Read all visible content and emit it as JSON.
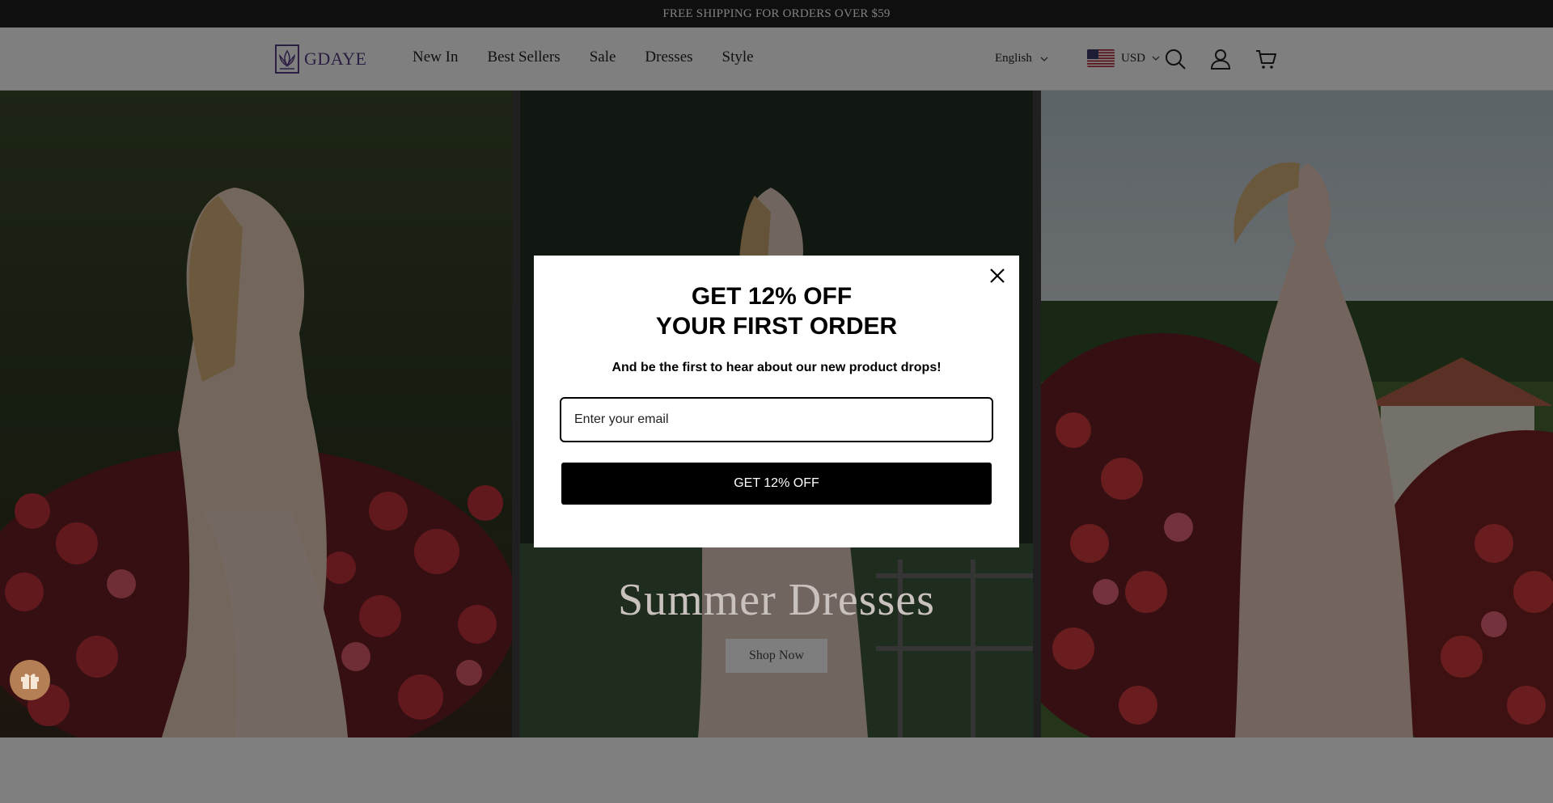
{
  "announcement": {
    "text": "FREE SHIPPING FOR ORDERS OVER $59"
  },
  "header": {
    "logo_text": "GDAYE",
    "nav": [
      "New In",
      "Best Sellers",
      "Sale",
      "Dresses",
      "Style"
    ],
    "language": "English",
    "currency": "USD"
  },
  "hero": {
    "title": "Summer Dresses",
    "cta": "Shop Now"
  },
  "popup": {
    "headline_line1": "GET 12% OFF",
    "headline_line2": "YOUR FIRST ORDER",
    "subtext": "And be the first to hear about our new product drops!",
    "email_placeholder": "Enter your email",
    "submit_label": "GET 12% OFF"
  },
  "colors": {
    "announcement_bg": "#1e1f20",
    "logo": "#5b3f86",
    "popup_button": "#000000",
    "gift_button": "#b57f55"
  }
}
